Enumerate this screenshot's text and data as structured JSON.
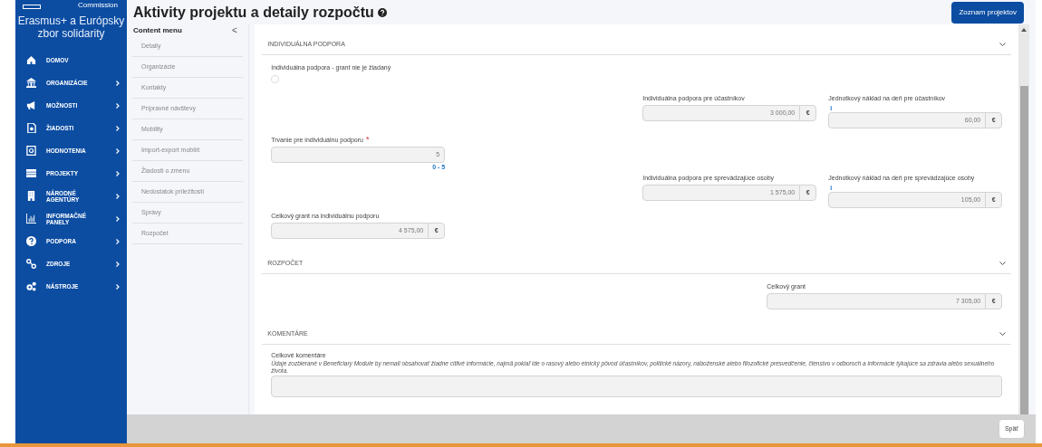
{
  "logo": {
    "text": "Commission"
  },
  "app_title": "Erasmus+ a Európsky zbor solidarity",
  "nav": [
    {
      "label": "DOMOV",
      "has_submenu": false
    },
    {
      "label": "ORGANIZÁCIE",
      "has_submenu": true
    },
    {
      "label": "MOŽNOSTI",
      "has_submenu": true
    },
    {
      "label": "ŽIADOSTI",
      "has_submenu": true
    },
    {
      "label": "HODNOTENIA",
      "has_submenu": true
    },
    {
      "label": "PROJEKTY",
      "has_submenu": true
    },
    {
      "label": "NÁRODNÉ AGENTÚRY",
      "has_submenu": true
    },
    {
      "label": "INFORMAČNÉ PANELY",
      "has_submenu": true
    },
    {
      "label": "PODPORA",
      "has_submenu": true
    },
    {
      "label": "ZDROJE",
      "has_submenu": true
    },
    {
      "label": "NÁSTROJE",
      "has_submenu": true
    }
  ],
  "page_title": "Aktivity projektu a detaily rozpočtu",
  "header_button": "Zoznam projektov",
  "content_menu": {
    "title": "Content menu",
    "collapse": "<",
    "items": [
      "Detaily",
      "Organizácie",
      "Kontakty",
      "Prípravné návštevy",
      "Mobility",
      "Import-export mobilít",
      "Žiadosti o zmenu",
      "Nedostatok príležitostí",
      "Správy",
      "Rozpočet"
    ]
  },
  "individual_support": {
    "title": "INDIVIDUÁLNA PODPORA",
    "no_grant": {
      "label": "Individuálna podpora - grant nie je žiadaný",
      "checked": false
    },
    "participants_support": {
      "label": "Individuálna podpora pre účastníkov",
      "value": "3 000,00",
      "unit": "€"
    },
    "participants_unit_cost": {
      "label": "Jednotkový náklad na deň pre účastníkov",
      "info": "i",
      "value": "60,00",
      "unit": "€"
    },
    "duration": {
      "label": "Trvanie pre individuálnu podporu",
      "required_mark": "*",
      "value": "5",
      "range": "0 - 5"
    },
    "accompanying_support": {
      "label": "Individuálna podpora pre sprevádzajúce osoby",
      "value": "1 575,00",
      "unit": "€"
    },
    "accompanying_unit_cost": {
      "label": "Jednotkový náklad na deň pre sprevádzajúce osoby",
      "info": "i",
      "value": "105,00",
      "unit": "€"
    },
    "total": {
      "label": "Celkový grant na individuálnu podporu",
      "value": "4 575,00",
      "unit": "€"
    }
  },
  "budget": {
    "title": "ROZPOČET",
    "total": {
      "label": "Celkový grant",
      "value": "7 305,00",
      "unit": "€"
    }
  },
  "comments": {
    "title": "KOMENTÁRE",
    "label": "Celkové komentáre",
    "note": "Údaje zozbierané v Beneficiary Module by nemali obsahovať žiadne citlivé informácie, najmä pokiaľ ide o rasový alebo etnický pôvod účastníkov, politické názory, náboženské alebo filozofické presvedčenie, členstvo v odboroch a informácie týkajúce sa zdravia alebo sexuálneho života."
  },
  "footer_button": "Späť"
}
